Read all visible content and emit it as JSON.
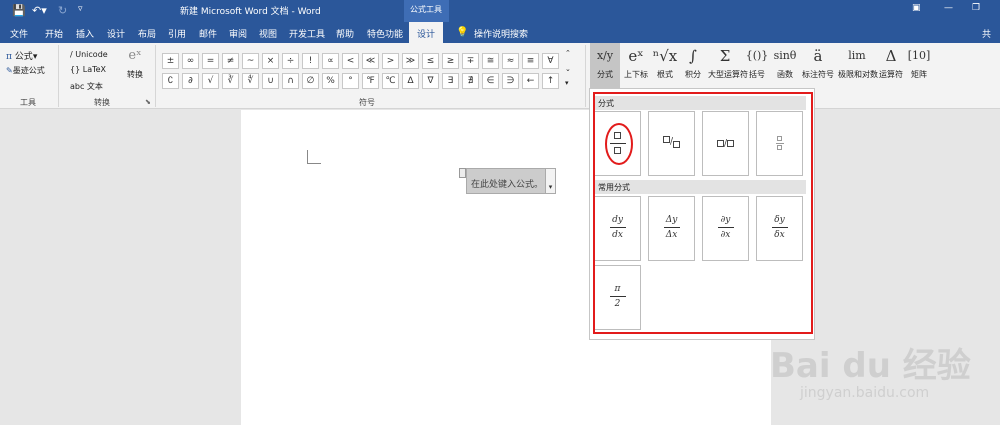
{
  "window": {
    "title": "新建 Microsoft Word 文档 - Word",
    "context_label": "公式工具",
    "user_initial": "共"
  },
  "tabs": [
    "文件",
    "开始",
    "插入",
    "设计",
    "布局",
    "引用",
    "邮件",
    "审阅",
    "视图",
    "开发工具",
    "帮助",
    "特色功能",
    "设计"
  ],
  "search": {
    "label": "操作说明搜索"
  },
  "ribbon": {
    "tools": {
      "equation": "公式",
      "ink_equation": "墨迹公式",
      "group_label": "工具"
    },
    "convert": {
      "unicode": "Unicode",
      "latex": "LaTeX",
      "text": "abc 文本",
      "convert_btn": "转换",
      "group_label": "转换"
    },
    "symbols": {
      "row1": [
        "±",
        "∞",
        "=",
        "≠",
        "~",
        "×",
        "÷",
        "!",
        "∝",
        "<",
        "≪",
        ">",
        "≫",
        "≤",
        "≥",
        "∓",
        "≅",
        "≈",
        "≡",
        "∀"
      ],
      "row2": [
        "∁",
        "∂",
        "√",
        "∛",
        "∜",
        "∪",
        "∩",
        "∅",
        "%",
        "°",
        "℉",
        "℃",
        "∆",
        "∇",
        "∃",
        "∄",
        "∈",
        "∋",
        "←",
        "↑"
      ],
      "group_label": "符号"
    },
    "structures": [
      {
        "icon": "x/y",
        "label": "分式"
      },
      {
        "icon": "eˣ",
        "label": "上下标"
      },
      {
        "icon": "ⁿ√x",
        "label": "根式"
      },
      {
        "icon": "∫",
        "label": "积分"
      },
      {
        "icon": "Σ",
        "label": "大型运算符"
      },
      {
        "icon": "{()}",
        "label": "括号"
      },
      {
        "icon": "sinθ",
        "label": "函数"
      },
      {
        "icon": "ä",
        "label": "标注符号"
      },
      {
        "icon": "lim",
        "label": "极限和对数"
      },
      {
        "icon": "Δ",
        "label": "运算符"
      },
      {
        "icon": "[10]",
        "label": "矩阵"
      }
    ]
  },
  "document": {
    "equation_placeholder": "在此处键入公式。"
  },
  "gallery": {
    "section1": "分式",
    "section2": "常用分式",
    "common": [
      {
        "n": "dy",
        "d": "dx"
      },
      {
        "n": "Δy",
        "d": "Δx"
      },
      {
        "n": "∂y",
        "d": "∂x"
      },
      {
        "n": "δy",
        "d": "δx"
      },
      {
        "n": "π",
        "d": "2"
      }
    ]
  },
  "watermark": {
    "brand": "Bai du 经验",
    "url": "jingyan.baidu.com"
  },
  "colors": {
    "title_bar": "#2b579a",
    "highlight": "#e21b1b"
  }
}
